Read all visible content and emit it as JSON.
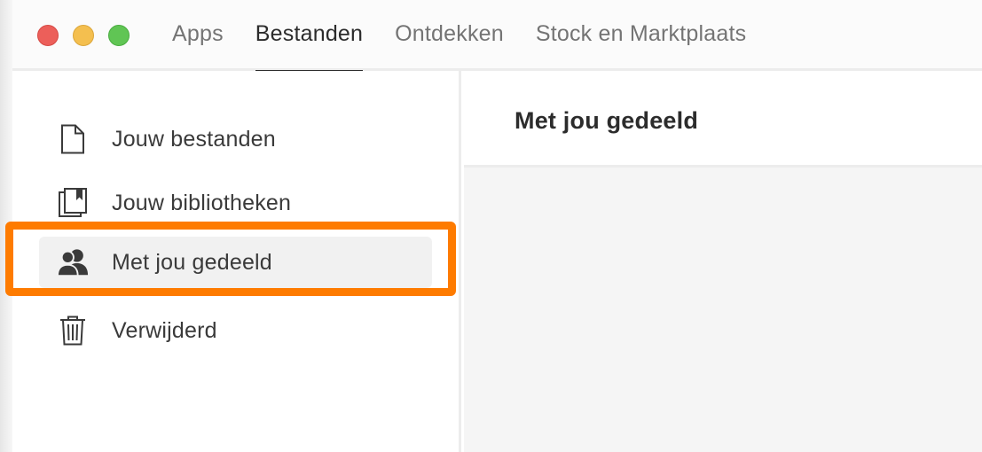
{
  "window_controls": {
    "close": "close",
    "minimize": "minimize",
    "zoom": "zoom"
  },
  "tabs": [
    {
      "label": "Apps",
      "active": false
    },
    {
      "label": "Bestanden",
      "active": true
    },
    {
      "label": "Ontdekken",
      "active": false
    },
    {
      "label": "Stock en Marktplaats",
      "active": false
    }
  ],
  "sidebar": {
    "items": [
      {
        "label": "Jouw bestanden",
        "icon": "document-icon",
        "selected": false
      },
      {
        "label": "Jouw bibliotheken",
        "icon": "library-icon",
        "selected": false
      },
      {
        "label": "Met jou gedeeld",
        "icon": "shared-users-icon",
        "selected": true
      },
      {
        "label": "Verwijderd",
        "icon": "trash-icon",
        "selected": false
      }
    ]
  },
  "main": {
    "title": "Met jou gedeeld"
  },
  "colors": {
    "highlight": "#fe7b00",
    "traffic_red": "#ec5f5a",
    "traffic_yellow": "#f4bf4f",
    "traffic_green": "#60c554"
  }
}
